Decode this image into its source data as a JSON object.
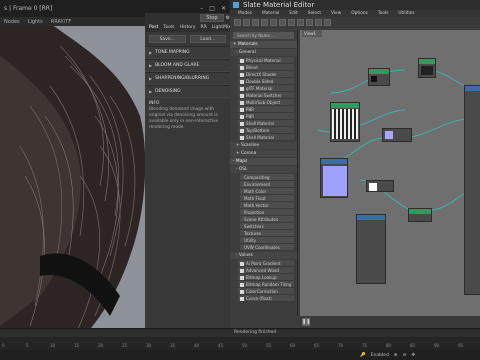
{
  "frame_window": {
    "title": "s | Frame 0 [RR]",
    "toolbar": [
      "Nodes",
      "Lights",
      "RRAY/TF"
    ],
    "render_panel": {
      "stop_label": "Stop",
      "tabs": [
        "Post",
        "Tools",
        "History",
        "RR",
        "LightMix"
      ],
      "active_tab": "Post",
      "save_label": "Save...",
      "load_label": "Load...",
      "sections": [
        "TONE MAPPING",
        "BLOOM AND GLARE",
        "SHARPENING/BLURRING",
        "DENOISING"
      ],
      "info_heading": "INFO",
      "info_text": "Blending denoised image with original via denoising amount is available only in non-interactive rendering mode."
    }
  },
  "slate": {
    "title": "Slate Material Editor",
    "menu": [
      "Modes",
      "Material",
      "Edit",
      "Select",
      "View",
      "Options",
      "Tools",
      "Utilities"
    ],
    "view_tab": "View1",
    "search_placeholder": "Search by Name ...",
    "browser": {
      "materials_header": "+ Materials",
      "general_group": "- General",
      "general_items": [
        "Physical Material",
        "Blend",
        "DirectX Shader",
        "Double Sided",
        "glTF Material",
        "Material Switcher",
        "Multi/Sub-Object",
        "PBR Material(Metal/Rou...",
        "PBR Material(Spec/Gloss)",
        "Shell Material",
        "Top/Bottom",
        "Shell Material"
      ],
      "scanline_group": "+ Scanline",
      "corona_group": "+ Corona",
      "maps_header": "- Maps",
      "osl_group": "- OSL",
      "osl_items": [
        "Compositing",
        "Environment",
        "Math Color",
        "Math Float",
        "Math Vector",
        "Projection",
        "Scene Attributes",
        "Switchers",
        "Textures",
        "Utility",
        "UVW Coordinates"
      ],
      "values_group": "- Values",
      "values_items": [
        "Ai Point Gradient",
        "Advanced Wood",
        "Bitmap Lookup",
        "Bitmap Random Tiling",
        "ColorCorrection",
        "Curve (float)"
      ]
    },
    "status_text": "Rendering finished",
    "selection": "1 ... ...",
    "zoom_label": "Enabled"
  },
  "timeline": {
    "ticks": [
      "0",
      "5",
      "10",
      "15",
      "20",
      "25",
      "30",
      "35",
      "40",
      "45",
      "50",
      "55",
      "60",
      "65",
      "70",
      "75",
      "80",
      "85",
      "90",
      "95"
    ]
  },
  "colors": {
    "node_green": "#2a9e5c",
    "node_blue": "#3a6ea8",
    "wire_teal": "#2ec4b6",
    "swatch_purple": "#a8a8ff"
  }
}
